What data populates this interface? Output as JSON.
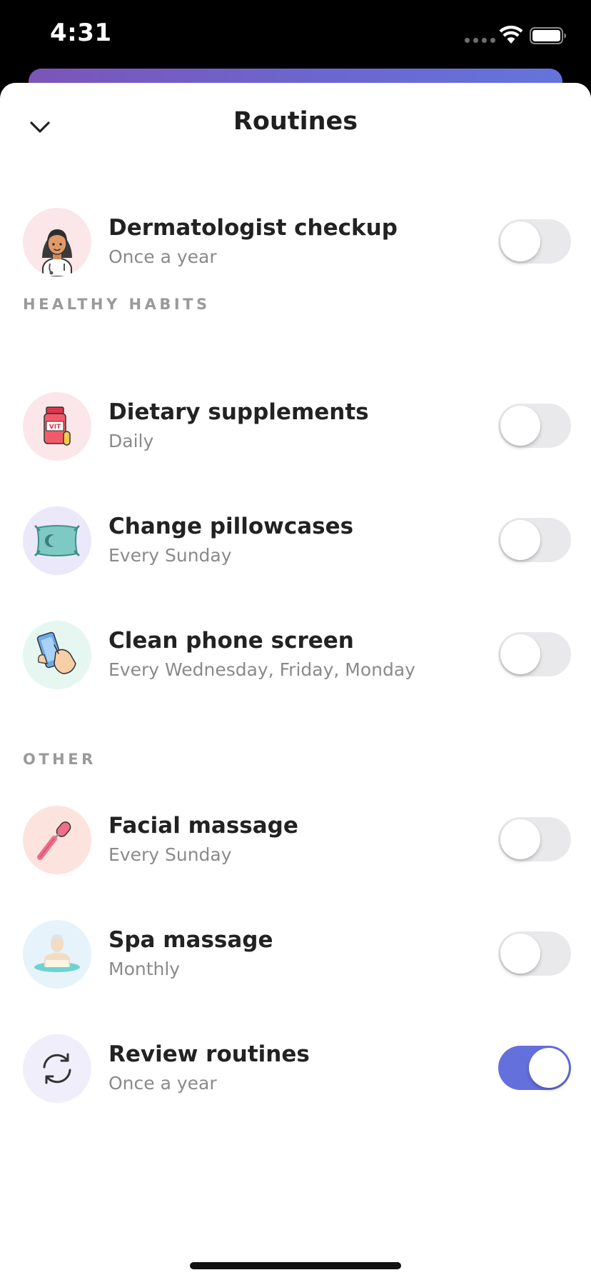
{
  "status_bar": {
    "time": "4:31"
  },
  "header": {
    "title": "Routines"
  },
  "colors": {
    "accent": "#6470dc",
    "toggle_off": "#e9e9eb",
    "header_gradient_start": "#7b55b8",
    "header_gradient_end": "#6474dc"
  },
  "routines": {
    "top": [
      {
        "title": "Dermatologist checkup",
        "subtitle": "Once a year",
        "icon": "dermatologist-icon",
        "enabled": false
      }
    ],
    "healthy_habits": {
      "label": "HEALTHY HABITS",
      "items": [
        {
          "title": "Dietary supplements",
          "subtitle": "Daily",
          "icon": "vitamin-bottle-icon",
          "enabled": false
        },
        {
          "title": "Change pillowcases",
          "subtitle": "Every Sunday",
          "icon": "pillow-icon",
          "enabled": false
        },
        {
          "title": "Clean phone screen",
          "subtitle": "Every Wednesday, Friday, Monday",
          "icon": "phone-cleaning-icon",
          "enabled": false
        }
      ]
    },
    "other": {
      "label": "OTHER",
      "items": [
        {
          "title": "Facial massage",
          "subtitle": "Every Sunday",
          "icon": "face-roller-icon",
          "enabled": false
        },
        {
          "title": "Spa massage",
          "subtitle": "Monthly",
          "icon": "spa-icon",
          "enabled": false
        },
        {
          "title": "Review routines",
          "subtitle": "Once a year",
          "icon": "refresh-icon",
          "enabled": true
        }
      ]
    }
  }
}
